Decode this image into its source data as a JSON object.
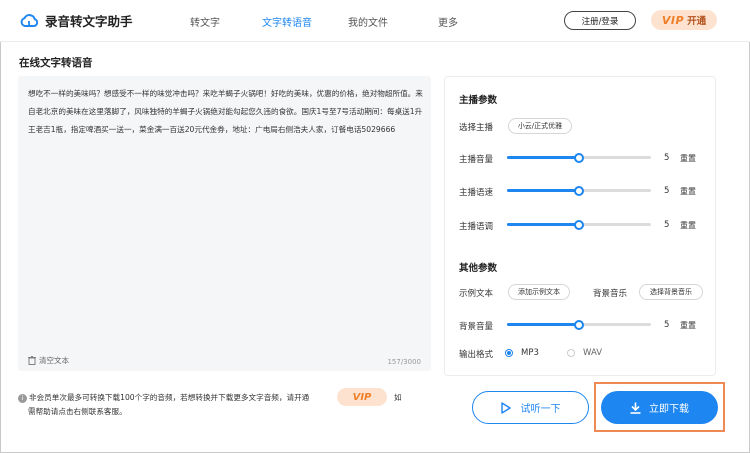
{
  "app": {
    "title": "录音转文字助手",
    "logo_icon": "cloud-logo-icon"
  },
  "nav": [
    {
      "label": "转文字",
      "active": false
    },
    {
      "label": "文字转语音",
      "active": true
    },
    {
      "label": "我的文件",
      "active": false
    },
    {
      "label": "更多",
      "active": false
    }
  ],
  "header": {
    "login_label": "注册/登录",
    "vip_label": "VIP",
    "vip_open_label": "开通"
  },
  "page": {
    "title": "在线文字转语音"
  },
  "editor": {
    "text": "想吃不一样的美味吗？想感受不一样的味觉冲击吗？来吃羊蝎子火锅吧！好吃的美味，优惠的价格，绝对物超所值。来自老北京的美味在这里落脚了，风味独特的羊蝎子火锅绝对能勾起您久违的食欲。国庆1号至7号活动期间：每桌送1升王老吉1瓶，指定啤酒买一送一，菜金满一百送20元代金券，地址：广电局右侧浩夫人家，订餐电话5029666",
    "clear_label": "清空文本",
    "char_count": "157/3000"
  },
  "settings": {
    "anchor_section": "主播参数",
    "anchor_label": "选择主播",
    "anchor_value": "小云/正式优雅",
    "sliders": [
      {
        "label": "主播音量",
        "value": "5",
        "level": 0.5,
        "reset": "重置"
      },
      {
        "label": "主播语速",
        "value": "5",
        "level": 0.5,
        "reset": "重置"
      },
      {
        "label": "主播语调",
        "value": "5",
        "level": 0.5,
        "reset": "重置"
      }
    ],
    "other_section": "其他参数",
    "sample_label": "示例文本",
    "sample_button": "添加示例文本",
    "bgm_label": "背景音乐",
    "bgm_button": "选择背景音乐",
    "bg_volume": {
      "label": "背景音量",
      "value": "5",
      "level": 0.5,
      "reset": "重置"
    },
    "format_label": "输出格式",
    "formats": [
      {
        "label": "MP3",
        "selected": true
      },
      {
        "label": "WAV",
        "selected": false
      }
    ]
  },
  "notice": {
    "text": "非会员单次最多可转换下载100个字的音频，若想转换并下载更多文字音频，请开通",
    "vip_label": "VIP",
    "tail_1": "如",
    "tail_2": "需帮助请点击右侧联系客服。"
  },
  "actions": {
    "listen_label": "试听一下",
    "download_label": "立即下载"
  },
  "colors": {
    "accent": "#1d86f0",
    "vip_bg": "#fde3cf",
    "vip_text": "#f07f2a",
    "highlight": "#f08a55"
  }
}
